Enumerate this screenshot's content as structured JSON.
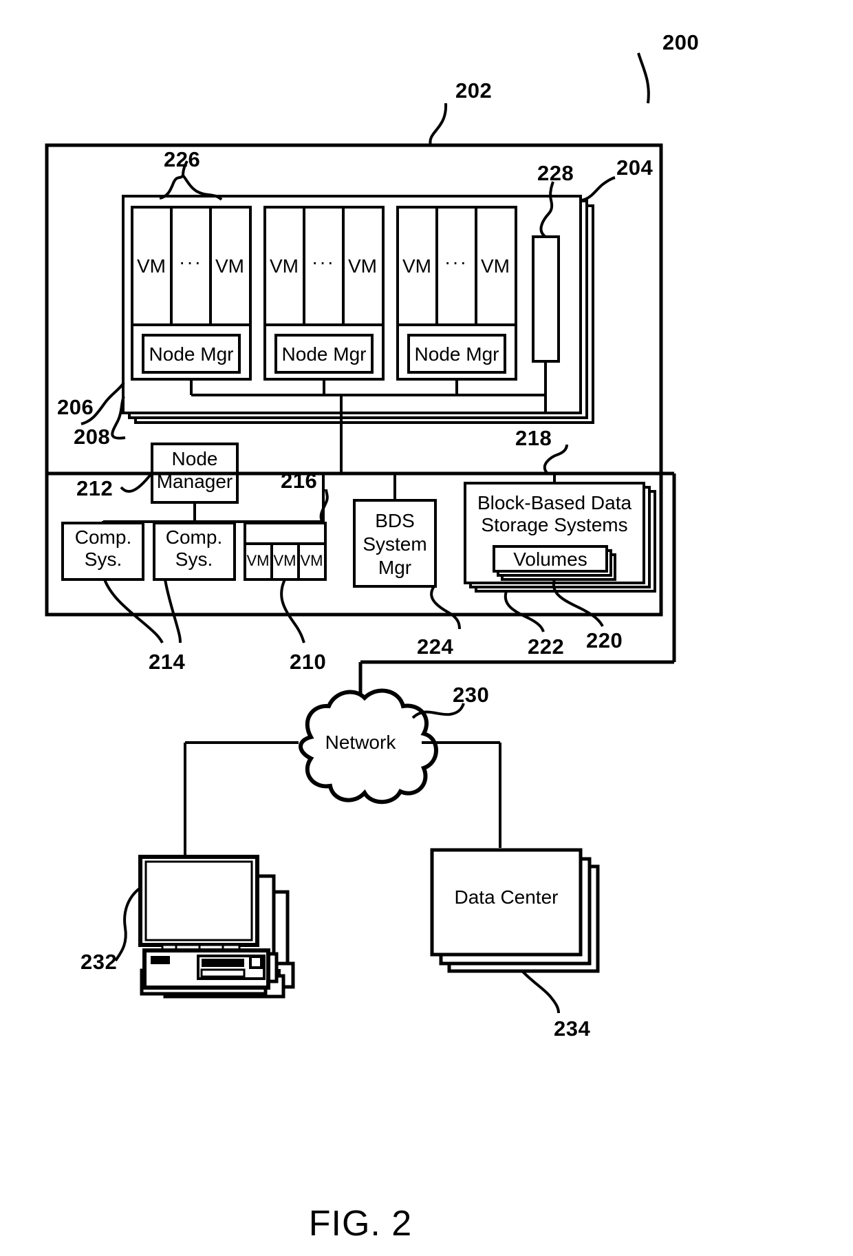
{
  "figure": {
    "caption": "FIG. 2",
    "top_ref": "200"
  },
  "refs": {
    "r200": "200",
    "r202": "202",
    "r204": "204",
    "r206": "206",
    "r208": "208",
    "r210": "210",
    "r212": "212",
    "r214": "214",
    "r216": "216",
    "r218": "218",
    "r220": "220",
    "r222": "222",
    "r224": "224",
    "r226": "226",
    "r228": "228",
    "r230": "230",
    "r232": "232",
    "r234": "234"
  },
  "racks": [
    {
      "node_mgr": "Node Mgr",
      "vm_left": "VM",
      "vm_dots": "···",
      "vm_right": "VM"
    },
    {
      "node_mgr": "Node Mgr",
      "vm_left": "VM",
      "vm_dots": "···",
      "vm_right": "VM"
    },
    {
      "node_mgr": "Node Mgr",
      "vm_left": "VM",
      "vm_dots": "···",
      "vm_right": "VM"
    }
  ],
  "node_manager": {
    "line1": "Node",
    "line2": "Manager"
  },
  "comp_sys": [
    {
      "line1": "Comp.",
      "line2": "Sys."
    },
    {
      "line1": "Comp.",
      "line2": "Sys."
    }
  ],
  "vm_host": {
    "vm1": "VM",
    "vm2": "VM",
    "vm3": "VM"
  },
  "bds_system_mgr": {
    "line1": "BDS",
    "line2": "System",
    "line3": "Mgr"
  },
  "block_storage": {
    "title_line1": "Block-Based Data",
    "title_line2": "Storage Systems",
    "volumes": "Volumes"
  },
  "network": {
    "label": "Network"
  },
  "data_center": {
    "label": "Data Center"
  },
  "colors": {
    "stroke": "#000000",
    "background": "#ffffff"
  }
}
